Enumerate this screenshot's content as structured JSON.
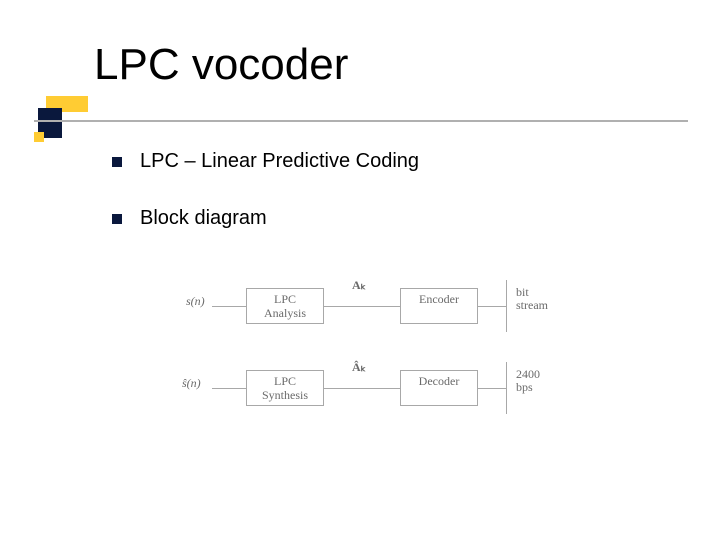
{
  "title": "LPC vocoder",
  "bullets": [
    "LPC – Linear Predictive Coding",
    "Block diagram"
  ],
  "diagram": {
    "top": {
      "input_label": "s(n)",
      "block1": "LPC\nAnalysis",
      "mid_label": "Aₖ",
      "block2": "Encoder",
      "right_label": "bit\nstream"
    },
    "bottom": {
      "output_label": "ŝ(n)",
      "block1": "LPC\nSynthesis",
      "mid_label": "Âₖ",
      "block2": "Decoder",
      "right_label": "2400\nbps"
    }
  }
}
